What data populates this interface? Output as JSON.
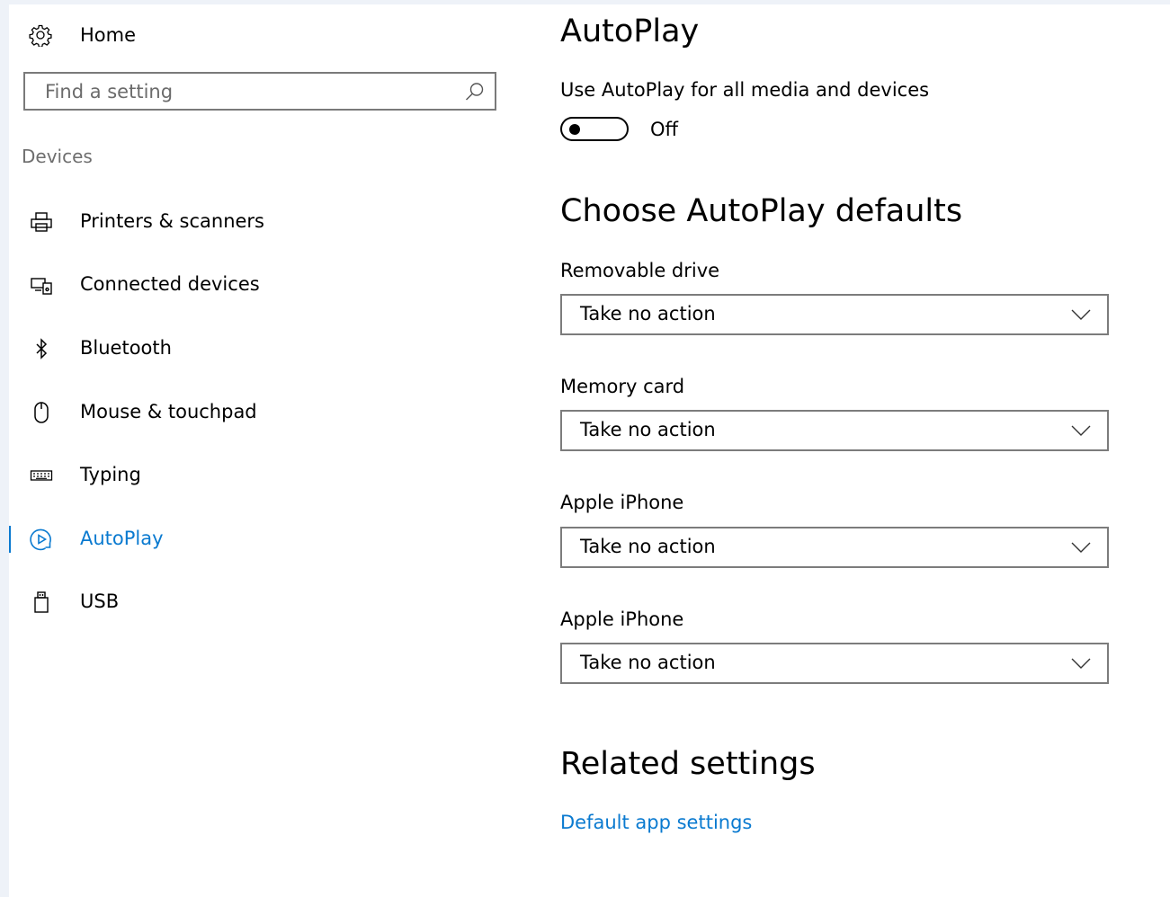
{
  "sidebar": {
    "home_label": "Home",
    "search": {
      "placeholder": "Find a setting"
    },
    "section_label": "Devices",
    "items": [
      {
        "label": "Printers & scanners",
        "icon": "printer-icon"
      },
      {
        "label": "Connected devices",
        "icon": "connected-devices-icon"
      },
      {
        "label": "Bluetooth",
        "icon": "bluetooth-icon"
      },
      {
        "label": "Mouse & touchpad",
        "icon": "mouse-icon"
      },
      {
        "label": "Typing",
        "icon": "keyboard-icon"
      },
      {
        "label": "AutoPlay",
        "icon": "autoplay-icon",
        "active": true
      },
      {
        "label": "USB",
        "icon": "usb-icon"
      }
    ]
  },
  "main": {
    "title": "AutoPlay",
    "use_autoplay_label": "Use AutoPlay for all media and devices",
    "toggle_state": "Off",
    "defaults_heading": "Choose AutoPlay defaults",
    "defaults": [
      {
        "label": "Removable drive",
        "value": "Take no action"
      },
      {
        "label": "Memory card",
        "value": "Take no action"
      },
      {
        "label": "Apple iPhone",
        "value": "Take no action"
      },
      {
        "label": "Apple iPhone",
        "value": "Take no action"
      }
    ],
    "related_heading": "Related settings",
    "related_link": "Default app settings"
  },
  "colors": {
    "accent": "#0a7ad0",
    "background": "#ffffff",
    "frame": "#eef2f8"
  }
}
